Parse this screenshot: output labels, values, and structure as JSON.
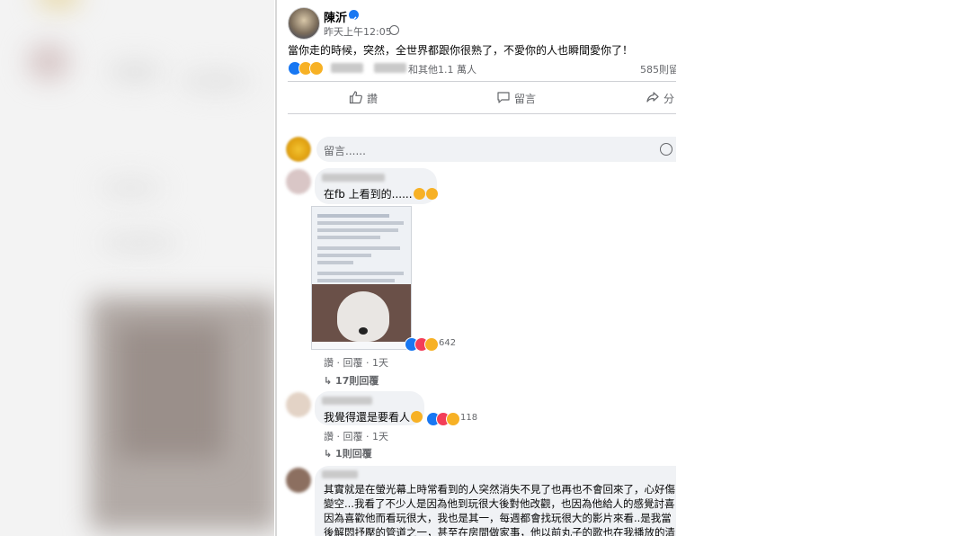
{
  "post": {
    "author": "陳沂",
    "timestamp": "昨天上午12:05",
    "privacy_icon": "globe-icon",
    "verified_icon": "verified-badge-icon",
    "text": "當你走的時候，突然，全世界都跟你很熟了，不愛你的人也瞬間愛你了！",
    "reactions_text": "和其他1.1 萬人",
    "comments_count": "585則留",
    "actions": {
      "like": "讚",
      "comment": "留言",
      "share": "分"
    }
  },
  "comment_input": {
    "placeholder": "留言......"
  },
  "comments": [
    {
      "text": "在fb 上看到的......",
      "reaction_count": "642",
      "actions": {
        "like": "讚",
        "reply": "回覆",
        "time": "1天"
      },
      "replies_link": "17則回覆"
    },
    {
      "text": "我覺得還是要看人",
      "reaction_count": "118",
      "actions": {
        "like": "讚",
        "reply": "回覆",
        "time": "1天"
      },
      "replies_link": "1則回覆"
    },
    {
      "lines": [
        "其實就是在螢光幕上時常看到的人突然消失不見了也再也不會回來了，心好傷",
        "變空...我看了不少人是因為他到玩很大後對他改觀，也因為他給人的感覺討喜",
        "因為喜歡他而看玩很大，我也是其一，每週都會找玩很大的影片來看..是我當",
        "後解悶抒壓的管道之一，甚至在房間做家事，他以前丸子的歌也在我播放的清"
      ]
    }
  ],
  "colors": {
    "like_blue": "#1877f2",
    "love_red": "#f33e58",
    "haha_yellow": "#f7b125",
    "meta_gray": "#65676b",
    "bubble_bg": "#f0f2f5"
  }
}
